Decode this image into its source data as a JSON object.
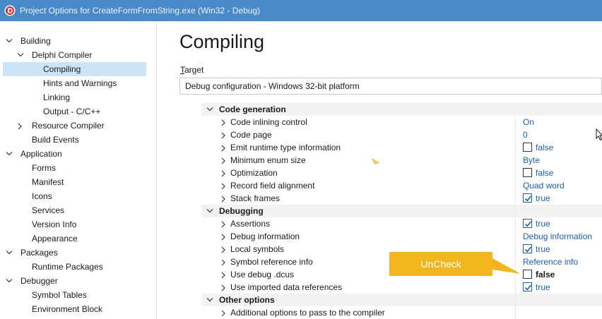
{
  "window": {
    "title": "Project Options for CreateFormFromString.exe  (Win32 - Debug)",
    "icon": "delphi-app-icon"
  },
  "tree": {
    "items": [
      {
        "label": "Building",
        "expanded": true
      },
      {
        "label": "Delphi Compiler",
        "expanded": true
      },
      {
        "label": "Compiling",
        "selected": true
      },
      {
        "label": "Hints and Warnings"
      },
      {
        "label": "Linking"
      },
      {
        "label": "Output - C/C++"
      },
      {
        "label": "Resource Compiler",
        "expanded": false
      },
      {
        "label": "Build Events"
      },
      {
        "label": "Application",
        "expanded": true
      },
      {
        "label": "Forms"
      },
      {
        "label": "Manifest"
      },
      {
        "label": "Icons"
      },
      {
        "label": "Services"
      },
      {
        "label": "Version Info"
      },
      {
        "label": "Appearance"
      },
      {
        "label": "Packages",
        "expanded": true
      },
      {
        "label": "Runtime Packages"
      },
      {
        "label": "Debugger",
        "expanded": true
      },
      {
        "label": "Symbol Tables"
      },
      {
        "label": "Environment Block"
      }
    ]
  },
  "main": {
    "title": "Compiling",
    "target_label": "Target",
    "target_value": "Debug configuration - Windows 32-bit platform"
  },
  "grid": {
    "groups": [
      {
        "label": "Code generation",
        "props": [
          {
            "name": "Code inlining control",
            "value": "On"
          },
          {
            "name": "Code page",
            "value": "0"
          },
          {
            "name": "Emit runtime type information",
            "value": "false",
            "checkbox": true,
            "checked": false
          },
          {
            "name": "Minimum enum size",
            "value": "Byte"
          },
          {
            "name": "Optimization",
            "value": "false",
            "checkbox": true,
            "checked": false
          },
          {
            "name": "Record field alignment",
            "value": "Quad word"
          },
          {
            "name": "Stack frames",
            "value": "true",
            "checkbox": true,
            "checked": true
          }
        ]
      },
      {
        "label": "Debugging",
        "props": [
          {
            "name": "Assertions",
            "value": "true",
            "checkbox": true,
            "checked": true
          },
          {
            "name": "Debug information",
            "value": "Debug information"
          },
          {
            "name": "Local symbols",
            "value": "true",
            "checkbox": true,
            "checked": true
          },
          {
            "name": "Symbol reference info",
            "value": "Reference info"
          },
          {
            "name": "Use debug .dcus",
            "value": "false",
            "checkbox": true,
            "checked": false,
            "bold": true
          },
          {
            "name": "Use imported data references",
            "value": "true",
            "checkbox": true,
            "checked": true
          }
        ]
      },
      {
        "label": "Other options",
        "props": [
          {
            "name": "Additional options to pass to the compiler",
            "value": ""
          }
        ]
      }
    ]
  },
  "annotation": {
    "label": "UnCheck",
    "color": "#f2b51e"
  },
  "colors": {
    "titlebar": "#4a8ac9",
    "selection": "#cce4f7",
    "value_text": "#1e5ea8"
  }
}
